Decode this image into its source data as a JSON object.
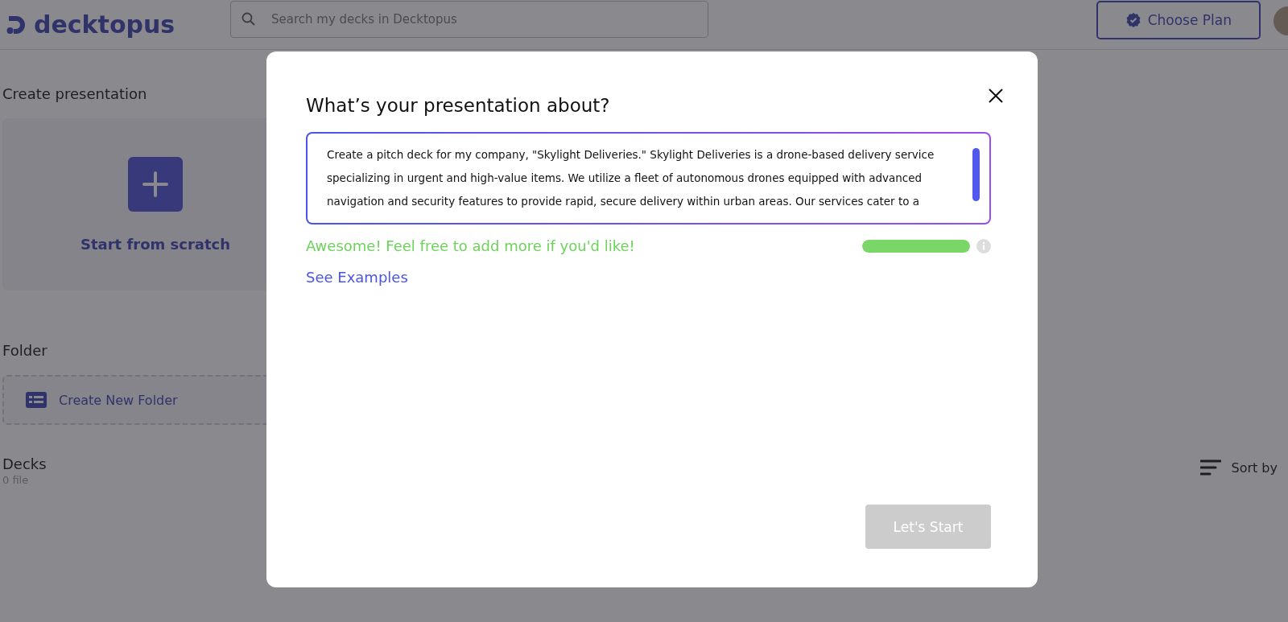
{
  "header": {
    "logo": "decktopus",
    "search": {
      "placeholder": "Search my decks in Decktopus"
    },
    "plan_button": "Choose Plan"
  },
  "create_section": {
    "title": "Create presentation",
    "card_label": "Start from scratch"
  },
  "folder_section": {
    "title": "Folder",
    "button": "Create New Folder"
  },
  "decks_section": {
    "title": "Decks",
    "count": "0 file",
    "sort_label": "Sort by"
  },
  "dialog": {
    "title": "What’s your presentation about?",
    "prompt": "Create a pitch deck for my company, \"Skylight Deliveries.\" Skylight Deliveries is a drone-based delivery service specializing in urgent and high-value items.  We utilize a fleet of autonomous drones equipped with advanced navigation and security features to provide rapid, secure delivery within urban areas. Our services cater to a",
    "feedback": "Awesome! Feel free to add more if you'd like!",
    "level": 1,
    "examples_link": "See Examples",
    "start_button": {
      "label": "Let's Start",
      "disabled": true
    }
  }
}
